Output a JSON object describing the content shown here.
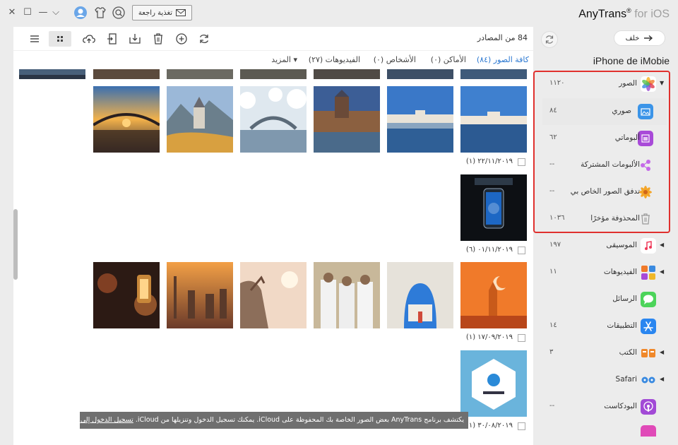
{
  "titlebar": {
    "feedback_label": "تغذية راجعة",
    "brand_name": "AnyTrans",
    "brand_reg": "®",
    "brand_for": " for iOS"
  },
  "toolbar": {
    "source_count": "84 من المصادر"
  },
  "filters": [
    {
      "label": "كافة الصور (٨٤)",
      "active": true
    },
    {
      "label": "الأماكن (٠)",
      "active": false
    },
    {
      "label": "الأشخاص (٠)",
      "active": false
    },
    {
      "label": "الفيديوهات (٢٧)",
      "active": false
    },
    {
      "label": "المزيد ▾",
      "active": false
    }
  ],
  "groups": [
    {
      "date": "٢٢/١١/٢٠١٩ (١)"
    },
    {
      "date": "٠١/١١/٢٠١٩ (٦)"
    },
    {
      "date": "١٧/٠٩/٢٠١٩ (١)"
    },
    {
      "date": "٣٠/٠٨/٢٠١٩ (١)"
    }
  ],
  "banner": {
    "text": "يكتشف برنامج AnyTrans بعض الصور الخاصة بك المحفوظة على iCloud. يمكنك تسجيل الدخول وتنزيلها من iCloud. ",
    "link": "تسجيل الدخول إلى iCloud >"
  },
  "sidebar": {
    "back_label": "خلف",
    "device_name": "iPhone de iMobie",
    "photos": {
      "label": "الصور",
      "count": "١١٢٠"
    },
    "photo_items": [
      {
        "label": "صوري",
        "count": "٨٤"
      },
      {
        "label": "ألبوماتي",
        "count": "٦٢"
      },
      {
        "label": "الألبومات المشتركة",
        "count": "--"
      },
      {
        "label": "تدفق الصور الخاص بي",
        "count": "--"
      },
      {
        "label": "المحذوفة مؤخرًا",
        "count": "١٠٣٦"
      }
    ],
    "categories": [
      {
        "label": "الموسيقى",
        "count": "١٩٧"
      },
      {
        "label": "الفيديوهات",
        "count": "١١"
      },
      {
        "label": "الرسائل",
        "count": ""
      },
      {
        "label": "التطبيقات",
        "count": "١٤"
      },
      {
        "label": "الكتب",
        "count": "٣"
      },
      {
        "label": "Safari",
        "count": ""
      },
      {
        "label": "البودكاست",
        "count": "--"
      }
    ]
  },
  "colors": {
    "accent": "#2a77d1",
    "highlight": "#e0302e"
  }
}
